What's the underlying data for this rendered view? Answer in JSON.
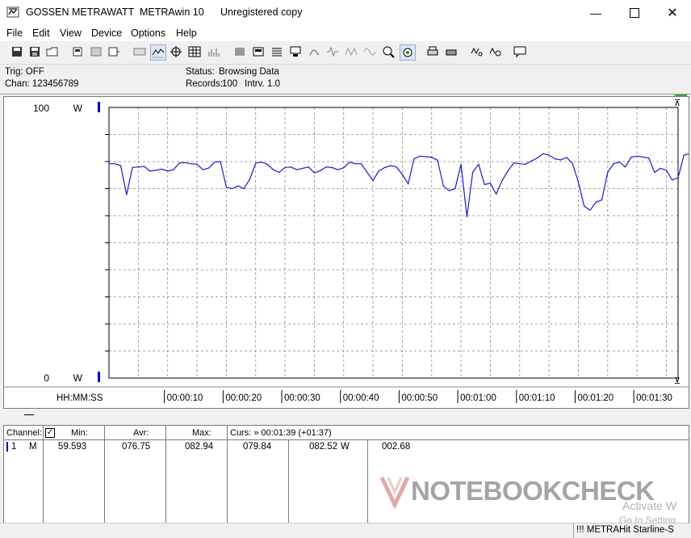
{
  "window": {
    "brand": "GOSSEN METRAWATT",
    "app": "METRAwin 10",
    "registration": "Unregistered copy"
  },
  "menu": [
    "File",
    "Edit",
    "View",
    "Device",
    "Options",
    "Help"
  ],
  "info": {
    "trig": "Trig: OFF",
    "chan": "Chan:  123456789",
    "status_label": "Status:",
    "status_value": "Browsing Data",
    "records_label": "Records:",
    "records_value": "100",
    "intrv_label": "Intrv.",
    "intrv_value": "1.0"
  },
  "colors": {
    "trace": "#1a1acc",
    "accent_green": "#33aa33",
    "channel_marker": "#0000cc"
  },
  "chart_data": {
    "type": "line",
    "y_top_label": "100",
    "y_bottom_label": "0",
    "y_unit": "W",
    "ylim": [
      0,
      100
    ],
    "x_axis_label": "HH:MM:SS",
    "x_ticks": [
      "00:00:10",
      "00:00:20",
      "00:00:30",
      "00:00:40",
      "00:00:50",
      "00:01:00",
      "00:01:10",
      "00:01:20",
      "00:01:30"
    ],
    "xlim": [
      0,
      97
    ],
    "grid": true,
    "series": [
      {
        "values": [
          79.2,
          79.2,
          78.5,
          67.8,
          77.8,
          78.0,
          78.2,
          76.5,
          76.8,
          77.2,
          76.5,
          77.0,
          79.5,
          79.6,
          79.2,
          79.0,
          77.0,
          77.6,
          79.8,
          80.0,
          70.5,
          70.0,
          71.0,
          70.0,
          73.5,
          79.4,
          79.8,
          79.0,
          77.0,
          76.0,
          77.8,
          78.0,
          77.0,
          77.5,
          78.0,
          75.8,
          76.6,
          78.0,
          77.8,
          77.0,
          77.7,
          79.8,
          79.2,
          79.2,
          76.0,
          73.0,
          76.5,
          77.8,
          78.5,
          78.0,
          75.2,
          71.8,
          81.0,
          82.0,
          81.8,
          81.6,
          80.5,
          71.0,
          69.2,
          70.0,
          79.0,
          59.6,
          76.0,
          79.0,
          71.5,
          72.0,
          68.0,
          73.0,
          76.5,
          79.5,
          79.2,
          79.0,
          80.2,
          81.3,
          82.9,
          82.4,
          81.0,
          80.6,
          81.5,
          79.3,
          72.5,
          63.5,
          62.0,
          65.0,
          65.8,
          76.0,
          79.2,
          79.8,
          78.0,
          81.6,
          82.0,
          81.7,
          81.3,
          76.0,
          77.5,
          76.8,
          73.2,
          74.0,
          82.4,
          82.9,
          82.5
        ]
      }
    ]
  },
  "table": {
    "headers": {
      "channel": "Channel:",
      "min": "Min:",
      "avr": "Avr:",
      "max": "Max:",
      "curs": "Curs: » 00:01:39 (+01:37)"
    },
    "row": {
      "channel_no": "1",
      "mode": "M",
      "min": "59.593",
      "avr": "076.75",
      "max": "082.94",
      "curs1": "079.84",
      "curs2": "082.52",
      "unit": "W",
      "diff": "002.68"
    }
  },
  "watermark": "NOTEBOOKCHECK",
  "activation_line1": "Activate W",
  "activation_line2": "Go to Setting",
  "statusbar": {
    "device": "!!! METRAHit Starline-S"
  }
}
